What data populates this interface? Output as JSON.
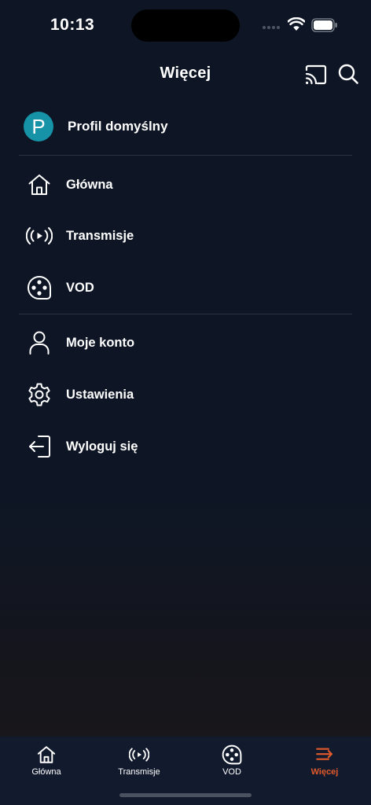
{
  "status_bar": {
    "time": "10:13"
  },
  "header": {
    "title": "Więcej",
    "cast_icon": "cast-icon",
    "search_icon": "search-icon"
  },
  "profile": {
    "initial": "P",
    "name": "Profil domyślny",
    "avatar_color": "#1793a8"
  },
  "menu": {
    "nav_items": [
      {
        "label": "Główna",
        "icon": "home-icon"
      },
      {
        "label": "Transmisje",
        "icon": "broadcast-icon"
      },
      {
        "label": "VOD",
        "icon": "film-reel-icon"
      }
    ],
    "account_items": [
      {
        "label": "Moje konto",
        "icon": "user-icon"
      },
      {
        "label": "Ustawienia",
        "icon": "gear-icon"
      },
      {
        "label": "Wyloguj się",
        "icon": "logout-icon"
      }
    ]
  },
  "tab_bar": {
    "tabs": [
      {
        "label": "Główna",
        "icon": "home-icon",
        "active": false
      },
      {
        "label": "Transmisje",
        "icon": "broadcast-icon",
        "active": false
      },
      {
        "label": "VOD",
        "icon": "film-reel-icon",
        "active": false
      },
      {
        "label": "Więcej",
        "icon": "menu-arrow-icon",
        "active": true
      }
    ],
    "active_color": "#e25a2c"
  }
}
